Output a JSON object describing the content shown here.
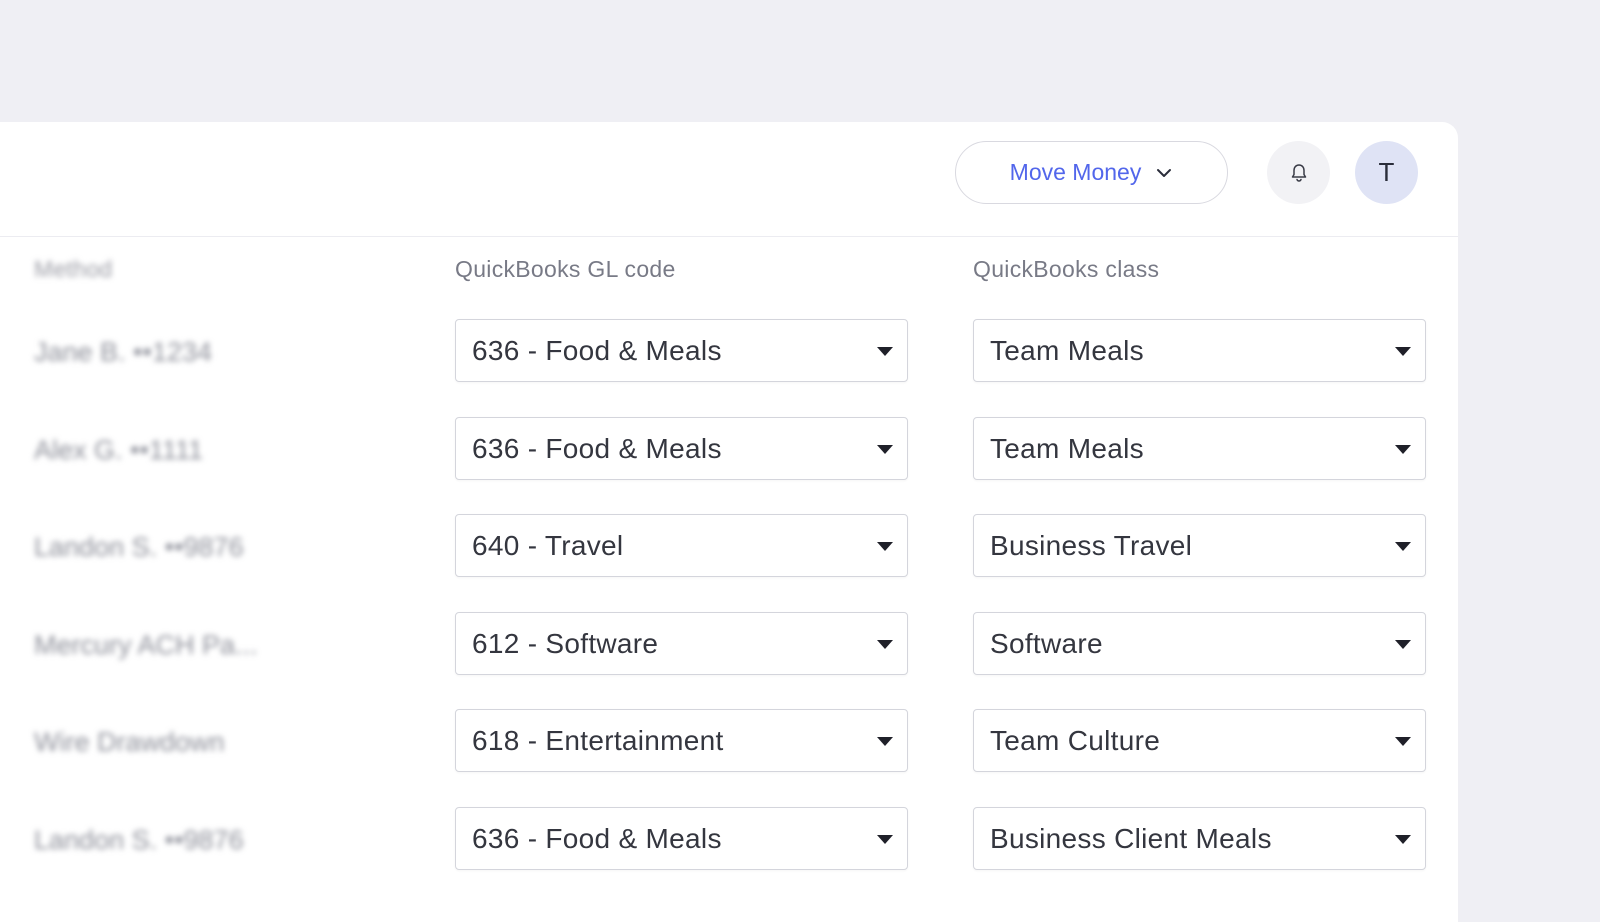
{
  "header": {
    "move_money_label": "Move Money",
    "move_money_icon": "chevron-down-icon",
    "bell_icon": "bell-icon",
    "avatar_initial": "T",
    "accent_color": "#5266eb"
  },
  "table": {
    "columns": {
      "method": "Method",
      "gl_code": "QuickBooks GL code",
      "class": "QuickBooks class"
    },
    "rows": [
      {
        "method": "Jane B. ••1234",
        "gl_code": "636 - Food & Meals",
        "class": "Team Meals"
      },
      {
        "method": "Alex G. ••1111",
        "gl_code": "636 - Food & Meals",
        "class": "Team Meals"
      },
      {
        "method": "Landon S. ••9876",
        "gl_code": "640 - Travel",
        "class": "Business Travel"
      },
      {
        "method": "Mercury ACH Pa...",
        "gl_code": "612 - Software",
        "class": "Software"
      },
      {
        "method": "Wire Drawdown",
        "gl_code": "618 - Entertainment",
        "class": "Team Culture"
      },
      {
        "method": "Landon S. ••9876",
        "gl_code": "636 - Food & Meals",
        "class": "Business Client Meals"
      }
    ]
  }
}
